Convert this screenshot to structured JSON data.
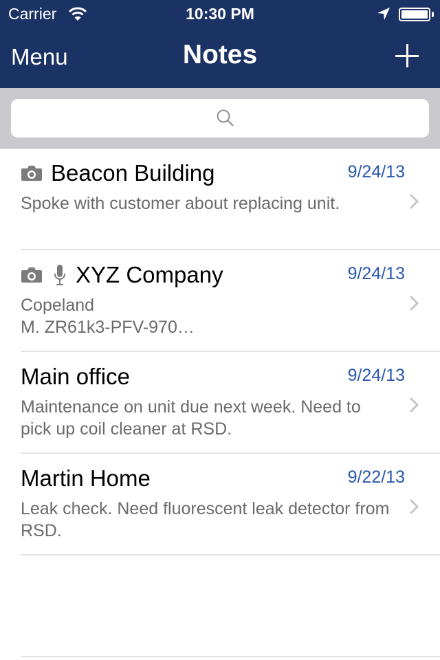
{
  "status_bar": {
    "carrier": "Carrier",
    "time": "10:30 PM",
    "icons": [
      "wifi-icon",
      "location-icon",
      "battery-icon"
    ]
  },
  "nav": {
    "left_label": "Menu",
    "title": "Notes",
    "right_icon": "plus-icon"
  },
  "search": {
    "placeholder": "",
    "value": "",
    "icon": "search-icon"
  },
  "notes": [
    {
      "title": "Beacon Building",
      "date": "9/24/13",
      "preview": "Spoke with customer about replacing unit.",
      "has_photo": true,
      "has_audio": false
    },
    {
      "title": "XYZ Company",
      "date": "9/24/13",
      "preview_line1": "Copeland",
      "preview_line2": "M. ZR61k3-PFV-970…",
      "has_photo": true,
      "has_audio": true
    },
    {
      "title": "Main office",
      "date": "9/24/13",
      "preview": "Maintenance on unit due next week. Need to pick up coil cleaner at RSD.",
      "has_photo": false,
      "has_audio": false
    },
    {
      "title": "Martin Home",
      "date": "9/22/13",
      "preview": "Leak check. Need fluorescent leak detector from RSD.",
      "has_photo": false,
      "has_audio": false
    }
  ],
  "colors": {
    "nav_background": "#1b3264",
    "date_text": "#2a58b0",
    "search_bar_background": "#c9c9ce"
  }
}
